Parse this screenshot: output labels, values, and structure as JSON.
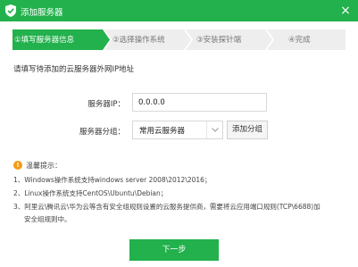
{
  "window": {
    "title": "添加服务器",
    "close_glyph": "×"
  },
  "steps": [
    {
      "label": "①填写服务器信息",
      "active": true
    },
    {
      "label": "②选择操作系统",
      "active": false
    },
    {
      "label": "③安装探针端",
      "active": false
    },
    {
      "label": "④完成",
      "active": false
    }
  ],
  "instruction": "请填写待添加的云服务器外网IP地址",
  "form": {
    "ip_label": "服务器IP：",
    "ip_value": "0.0.0.0",
    "group_label": "服务器分组：",
    "group_value": "常用云服务器",
    "add_group_label": "添加分组"
  },
  "tips": {
    "icon": "!",
    "title": "温馨提示：",
    "items": [
      "1、Windows操作系统支持windows server 2008\\2012\\2016；",
      "2、Linux操作系统支持CentOS\\Ubuntu\\Debian；",
      "3、阿里云\\腾讯云\\华为云等含有安全组规则设置的云服务提供商，需要将云应用端口规则(TCP\\6688)加",
      "安全组规则中。"
    ]
  },
  "footer": {
    "next_label": "下一步"
  },
  "colors": {
    "accent": "#22b14c",
    "step_inactive": "#eeeeee",
    "warning": "#f39c12"
  }
}
